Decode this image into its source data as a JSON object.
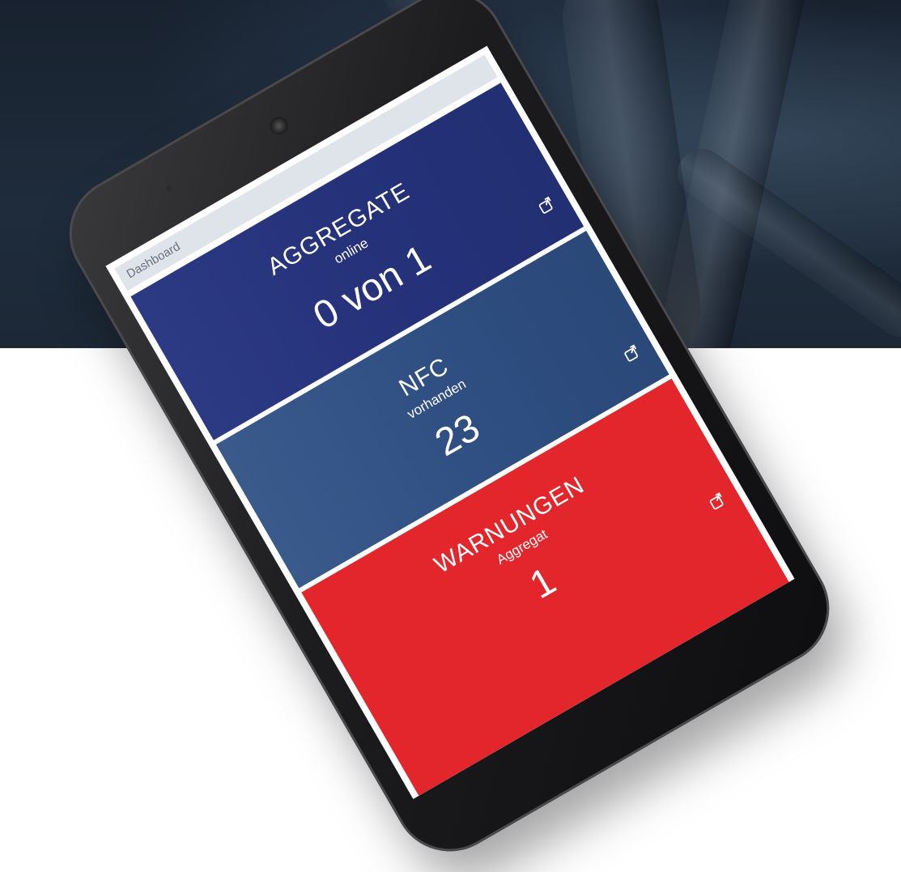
{
  "header": {
    "title": "Dashboard"
  },
  "tiles": [
    {
      "title": "AGGREGATE",
      "subtitle": "online",
      "value": "0 von 1"
    },
    {
      "title": "NFC",
      "subtitle": "vorhanden",
      "value": "23"
    },
    {
      "title": "WARNUNGEN",
      "subtitle": "Aggregat",
      "value": "1"
    }
  ],
  "colors": {
    "aggregate_tile": "#2a3880",
    "nfc_tile": "#345486",
    "warnungen_tile": "#e3262b"
  },
  "icons": {
    "tile_action": "external-link-icon"
  }
}
